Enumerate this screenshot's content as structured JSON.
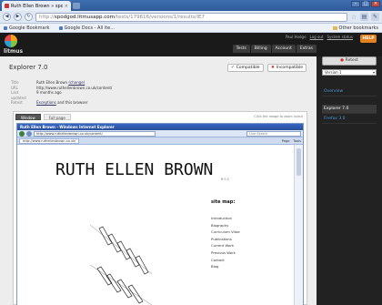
{
  "browser": {
    "tab_title": "Ruth Ellen Brown » spo...",
    "url_scheme": "http://",
    "url_host": "spodgod.litmusapp.com",
    "url_path": "/tests/179616/versions/1/results/IE7",
    "bookmarks": [
      "Google Bookmark",
      "Google Docs - All ite..."
    ],
    "other_bookmarks": "Other bookmarks"
  },
  "header": {
    "brand": "litmus",
    "top_links": [
      "Paul Hodge",
      "Log out",
      "System status"
    ],
    "help_label": "HELP",
    "nav": [
      "Tests",
      "Billing",
      "Account",
      "Extras"
    ]
  },
  "main": {
    "title": "Explorer 7.0",
    "compatible_label": "Compatible",
    "incompatible_label": "Incompatible",
    "meta": [
      {
        "key": "Title",
        "value": "Ruth Ellen Brown",
        "extra": "(change)"
      },
      {
        "key": "URL",
        "value": "http://www.ruthellenbrown.co.uk/content/",
        "extra": ""
      },
      {
        "key": "Last updated",
        "value": "9 months ago",
        "extra": ""
      },
      {
        "key": "Retest",
        "value": "Exceptions",
        "extra": "and this browser"
      }
    ],
    "view_tabs": [
      "Window",
      "Full page"
    ],
    "click_note": "Click the image to zoom in/out"
  },
  "ie": {
    "title": "Ruth Ellen Brown - Windows Internet Explorer",
    "url": "http://www.ruthellenbrown.co.uk/content/",
    "search_placeholder": "Live Search",
    "tab": "http://www.ruthellenbrown.co.uk/",
    "tools": [
      "Page",
      "Tools"
    ]
  },
  "site": {
    "name": "RUTH ELLEN BROWN",
    "sub": "BSS",
    "sitemap_title": "site map:",
    "links": [
      "Introduction",
      "Biography",
      "Curriculum Vitae",
      "Publications",
      "Current Work",
      "Previous Work",
      "Contact",
      "Blog"
    ]
  },
  "sidebar": {
    "retest_label": "Retest",
    "version_value": "Version 1",
    "items": [
      "Overview",
      "Explorer 7.0",
      "Firefox 3.0"
    ]
  }
}
